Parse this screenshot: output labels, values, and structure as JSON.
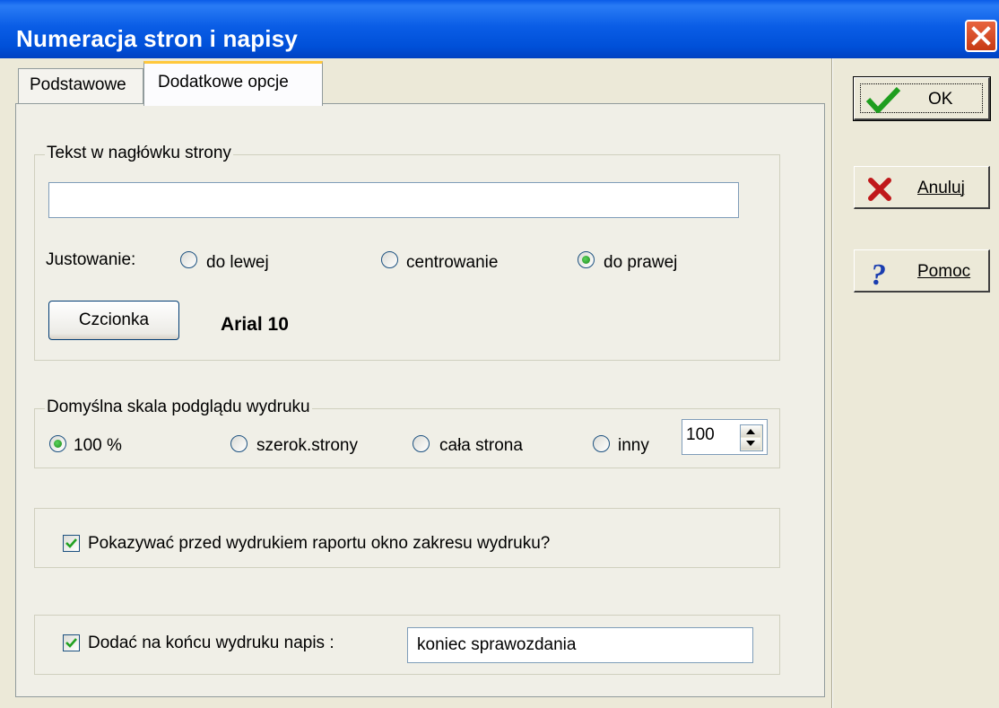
{
  "window": {
    "title": "Numeracja stron i napisy"
  },
  "tabs": [
    {
      "label": "Podstawowe"
    },
    {
      "label": "Dodatkowe opcje",
      "active": true
    }
  ],
  "header_group": {
    "legend": "Tekst w nagłówku strony",
    "text_value": "",
    "justify_label": "Justowanie:",
    "justify_options": [
      {
        "label": "do lewej",
        "checked": false
      },
      {
        "label": "centrowanie",
        "checked": false
      },
      {
        "label": "do prawej",
        "checked": true
      }
    ],
    "font_button": "Czcionka",
    "font_value": "Arial 10"
  },
  "scale_group": {
    "legend": "Domyślna skala podglądu wydruku",
    "options": [
      {
        "label": "100 %",
        "checked": true
      },
      {
        "label": "szerok.strony",
        "checked": false
      },
      {
        "label": "cała strona",
        "checked": false
      },
      {
        "label": "inny",
        "checked": false
      }
    ],
    "custom_value": "100"
  },
  "show_range": {
    "label": "Pokazywać przed wydrukiem raportu okno zakresu wydruku?",
    "checked": true
  },
  "footer_text": {
    "label": "Dodać na końcu wydruku napis :",
    "checked": true,
    "value": "koniec sprawozdania"
  },
  "buttons": {
    "ok": "OK",
    "cancel": "Anuluj",
    "help": "Pomoc"
  },
  "colors": {
    "titlebar": "#0054e3",
    "accent_tab": "#ffc83c",
    "radio_dot": "#21a121",
    "face": "#ece9d8"
  }
}
